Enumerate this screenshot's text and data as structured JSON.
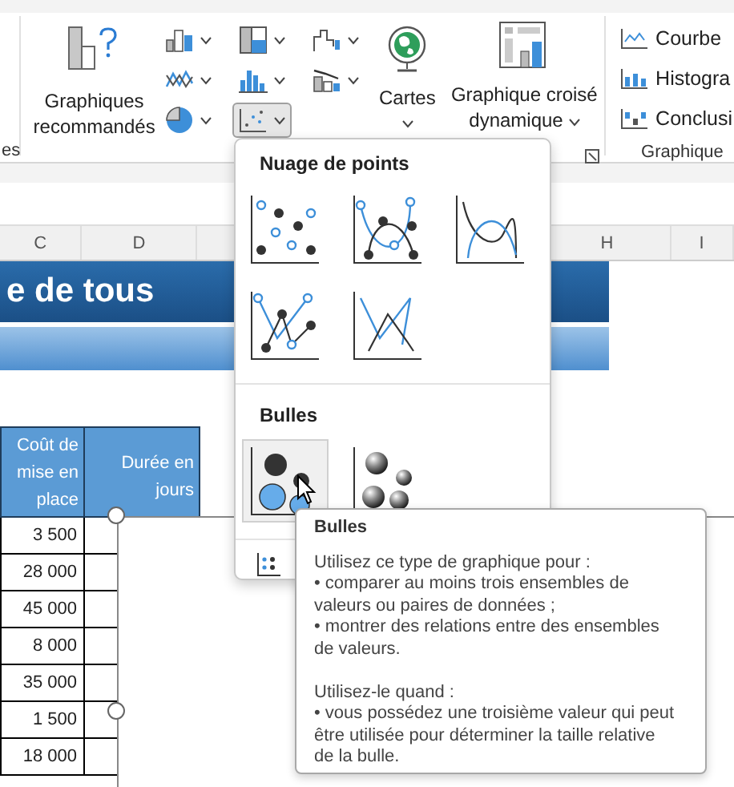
{
  "ribbon": {
    "left_group_label": "es",
    "recommended_label": "Graphiques recommandés",
    "chart_buttons": [
      {
        "kind": "column",
        "selected": false
      },
      {
        "kind": "line",
        "selected": false
      },
      {
        "kind": "pie",
        "selected": false
      },
      {
        "kind": "hierarchy",
        "selected": false
      },
      {
        "kind": "statistic",
        "selected": false
      },
      {
        "kind": "scatter",
        "selected": true
      },
      {
        "kind": "waterfall",
        "selected": false
      },
      {
        "kind": "combo",
        "selected": false
      }
    ],
    "maps_label": "Cartes",
    "pivot_label": "Graphique croisé dynamique",
    "sparklines": [
      {
        "kind": "line",
        "label": "Courbe"
      },
      {
        "kind": "column",
        "label": "Histogra"
      },
      {
        "kind": "winloss",
        "label": "Conclusi"
      }
    ],
    "right_group_label": "Graphique"
  },
  "sheet": {
    "columns": [
      {
        "label": "C"
      },
      {
        "label": "D"
      },
      {
        "label": "H"
      },
      {
        "label": "I"
      }
    ],
    "title": "e de tous",
    "table_headers": [
      "Coût de mise en place",
      "Durée en jours"
    ],
    "values": [
      "3 500",
      "28 000",
      "45 000",
      "8 000",
      "35 000",
      "1 500",
      "18 000"
    ]
  },
  "dropdown": {
    "sections": [
      {
        "title": "Nuage de points",
        "items": [
          {
            "kind": "scatter",
            "selected": false
          },
          {
            "kind": "smooth-markers",
            "selected": false
          },
          {
            "kind": "smooth",
            "selected": false
          },
          {
            "kind": "straight-markers",
            "selected": false
          },
          {
            "kind": "straight",
            "selected": false
          }
        ]
      },
      {
        "title": "Bulles",
        "items": [
          {
            "kind": "bubble",
            "selected": true
          },
          {
            "kind": "bubble-3d",
            "selected": false
          }
        ]
      }
    ]
  },
  "tooltip": {
    "title": "Bulles",
    "lines": [
      {
        "kind": "text",
        "text": "Utilisez ce type de graphique pour :"
      },
      {
        "kind": "text",
        "text": "• comparer au moins trois ensembles de valeurs ou paires de données ;"
      },
      {
        "kind": "text",
        "text": "• montrer des relations entre des ensembles de valeurs."
      },
      {
        "kind": "gap"
      },
      {
        "kind": "text",
        "text": "Utilisez-le quand :"
      },
      {
        "kind": "text",
        "text": "• vous possédez une troisième valeur qui peut être utilisée pour déterminer la taille relative de la bulle."
      }
    ]
  }
}
